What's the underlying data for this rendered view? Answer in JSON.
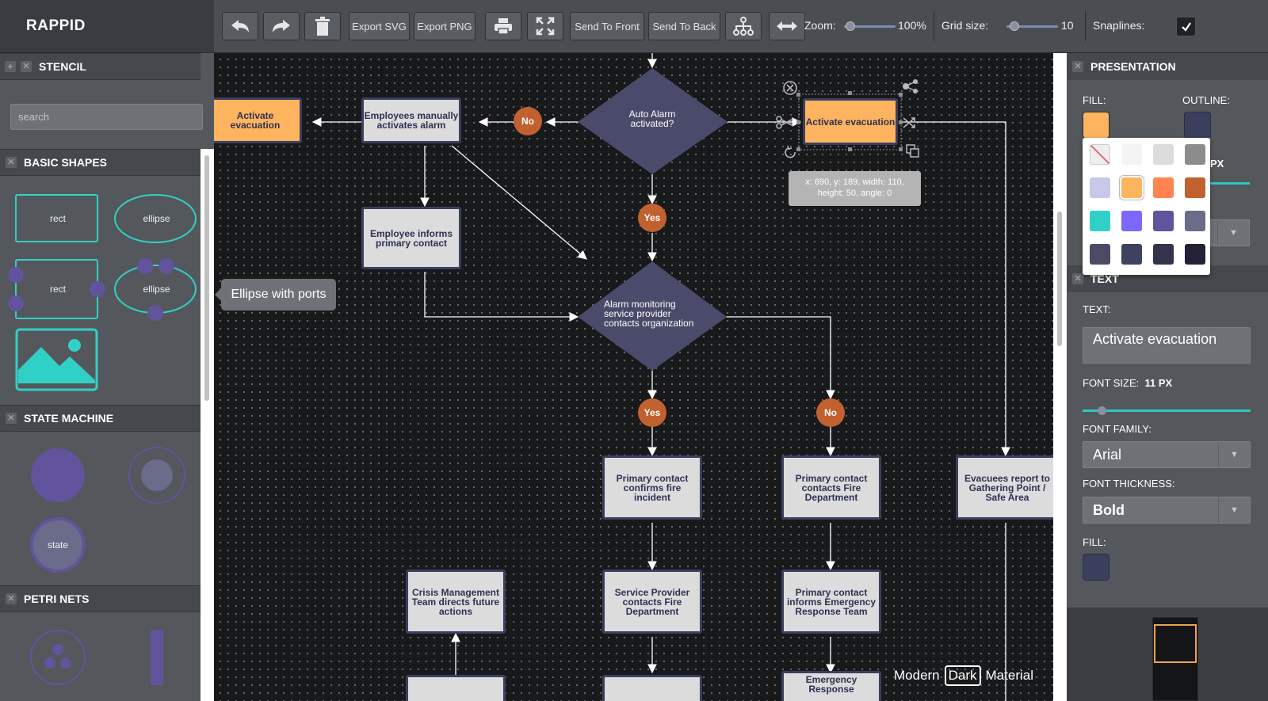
{
  "app": {
    "title": "RAPPID"
  },
  "toolbar": {
    "export_svg": "Export SVG",
    "export_png": "Export PNG",
    "send_front": "Send To Front",
    "send_back": "Send To Back",
    "zoom_label": "Zoom:",
    "zoom_value": "100%",
    "zoom_level": 0.1,
    "grid_label": "Grid size:",
    "grid_value": "10",
    "snap_label": "Snaplines:",
    "snap_checked": true,
    "icons": [
      "undo-icon",
      "redo-icon",
      "trash-icon",
      "print-icon",
      "fullscreen-icon",
      "tree-layout-icon",
      "fit-width-icon"
    ]
  },
  "stencil": {
    "title": "STENCIL",
    "search_placeholder": "search",
    "groups": [
      {
        "title": "BASIC SHAPES",
        "shapes": [
          "rect",
          "ellipse",
          "rect",
          "ellipse",
          "image"
        ]
      },
      {
        "title": "STATE MACHINE",
        "shapes": [
          "start",
          "end",
          "state"
        ]
      },
      {
        "title": "PETRI NETS",
        "shapes": [
          "place",
          "transition"
        ]
      }
    ],
    "tooltip": "Ellipse with ports"
  },
  "diagram": {
    "nodes": {
      "act_left": "Activate evacuation",
      "emp_manual": "Employees manually activates alarm",
      "auto_alarm": "Auto Alarm activated?",
      "act_selected": "Activate evacuation",
      "emp_informs": "Employee informs primary contact",
      "alarm_monitor": "Alarm monitoring service provider contacts organization",
      "pc_confirms": "Primary contact confirms fire incident",
      "pc_contacts": "Primary contact contacts Fire Department",
      "evacuees": "Evacuees report to Gathering Point / Safe Area",
      "crisis": "Crisis Management Team directs future actions",
      "sp_contacts": "Service Provider contacts Fire Department",
      "pc_informs": "Primary contact informs Emergency Response Team",
      "emergency_partial": "Emergency Response"
    },
    "labels": {
      "no1": "No",
      "yes1": "Yes",
      "yes2": "Yes",
      "no2": "No"
    },
    "geometry_tooltip_line1": "x: 690, y: 189, width: 110,",
    "geometry_tooltip_line2": "height: 50, angle: 0",
    "themes": [
      "Modern",
      "Dark",
      "Material"
    ],
    "active_theme": "Dark",
    "colors": {
      "action": "#feb45f",
      "process": "#dcdcdc",
      "decision": "#4a4a6a",
      "label": "#c1612f"
    }
  },
  "inspector": {
    "presentation_title": "PRESENTATION",
    "fill_label": "FILL:",
    "outline_label": "OUTLINE:",
    "outline_width_fragment": "PX",
    "text_section_title": "TEXT",
    "text_label": "TEXT:",
    "text_value": "Activate evacuation",
    "font_size_label": "FONT SIZE:",
    "font_size_value": "11 PX",
    "font_size_level": 0.1,
    "font_family_label": "FONT FAMILY:",
    "font_family_value": "Arial",
    "font_thickness_label": "FONT THICKNESS:",
    "font_thickness_value": "Bold",
    "text_fill_label": "FILL:",
    "fill_color": "#feb45f",
    "outline_color": "#3a3f5e",
    "text_fill_color": "#3a3f5e",
    "palette": [
      "transparent",
      "#f4f4f4",
      "#dcdcdc",
      "#8c8c8c",
      "#c8c8e8",
      "#feb45f",
      "#fe854f",
      "#c1612f",
      "#31d0c6",
      "#7c68fc",
      "#61549c",
      "#6a6c8a",
      "#4b4a67",
      "#3c4260",
      "#33334e",
      "#222138"
    ]
  }
}
